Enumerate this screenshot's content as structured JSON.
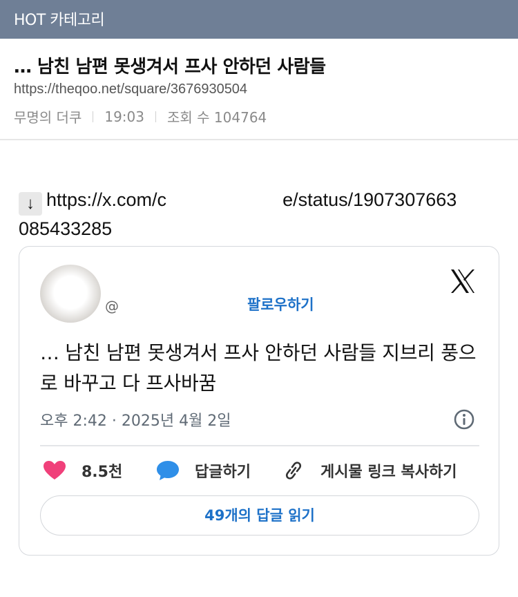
{
  "header": {
    "category": "HOT 카테고리"
  },
  "post": {
    "title": "… 남친 남편 못생겨서 프사 안하던 사람들",
    "url": "https://theqoo.net/square/3676930504",
    "author": "무명의 더쿠",
    "time": "19:03",
    "views_label": "조회 수 104764"
  },
  "body": {
    "arrow": "↓",
    "link_prefix": "https://x.com/c",
    "link_suffix": "e/status/1907307663",
    "link_line2": "085433285"
  },
  "tweet": {
    "handle_prefix": "@",
    "follow_label": "팔로우하기",
    "text": "… 남친 남편 못생겨서 프사 안하던 사람들 지브리 풍으로 바꾸고 다 프사바꿈",
    "timestamp": "오후 2:42 · 2025년 4월 2일",
    "like_count": "8.5천",
    "reply_label": "답글하기",
    "copy_link_label": "게시물 링크 복사하기",
    "read_replies_label": "49개의 답글 읽기"
  },
  "icons": {
    "x_logo": "x-logo-icon",
    "heart": "heart-icon",
    "reply": "speech-bubble-icon",
    "link": "link-icon",
    "info": "info-icon"
  },
  "colors": {
    "topbar": "#6f7f96",
    "heart": "#f0407a",
    "reply_bubble": "#2f8fe8",
    "follow": "#1d71c8"
  }
}
